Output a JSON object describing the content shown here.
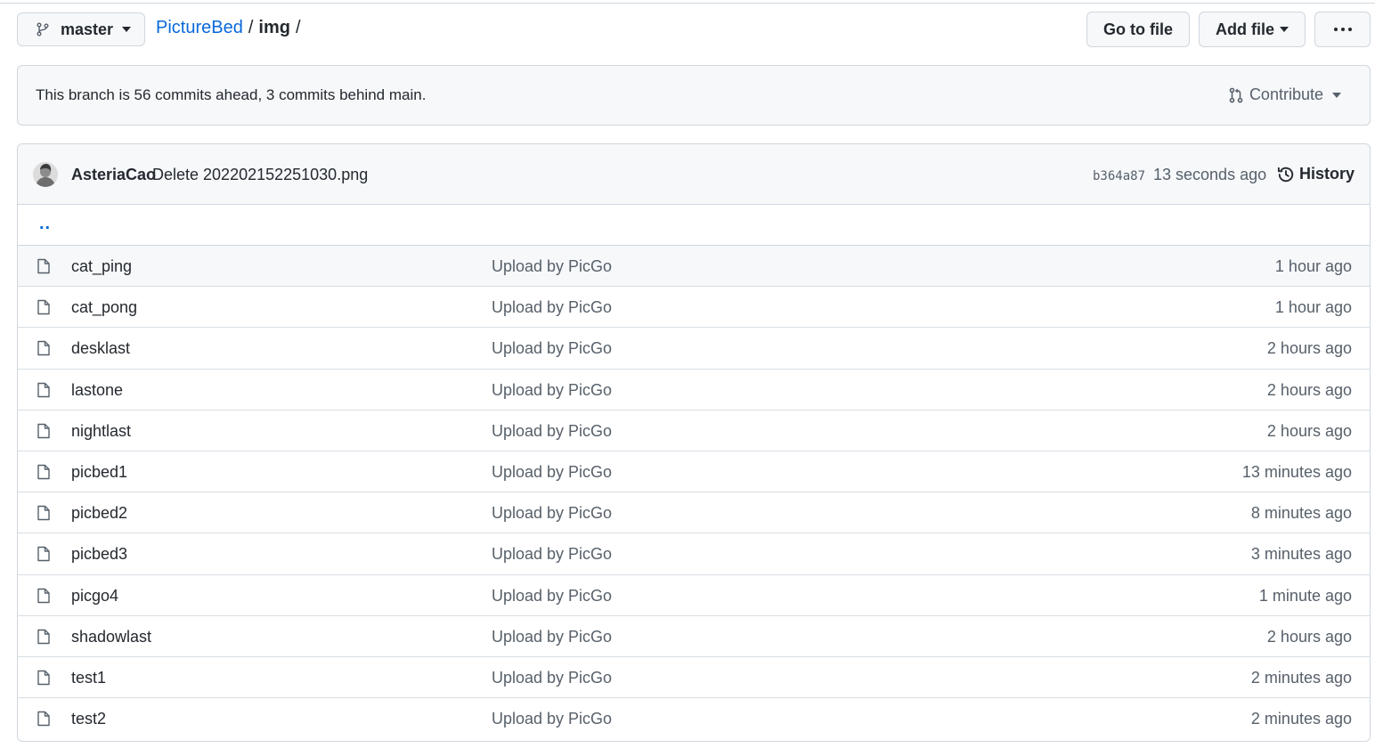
{
  "header": {
    "branch": "master",
    "breadcrumb": {
      "repo": "PictureBed",
      "sep1": "/",
      "folder": "img",
      "sep2": "/"
    },
    "go_to_file": "Go to file",
    "add_file": "Add file",
    "more": "···"
  },
  "banner": {
    "text": "This branch is 56 commits ahead, 3 commits behind main.",
    "contribute": "Contribute"
  },
  "latest_commit": {
    "author": "AsteriaCao",
    "message": "Delete 202202152251030.png",
    "sha": "b364a87",
    "time": "13 seconds ago",
    "history": "History"
  },
  "parent_dir": "..",
  "files": [
    {
      "name": "cat_ping",
      "message": "Upload by PicGo",
      "age": "1 hour ago"
    },
    {
      "name": "cat_pong",
      "message": "Upload by PicGo",
      "age": "1 hour ago"
    },
    {
      "name": "desklast",
      "message": "Upload by PicGo",
      "age": "2 hours ago"
    },
    {
      "name": "lastone",
      "message": "Upload by PicGo",
      "age": "2 hours ago"
    },
    {
      "name": "nightlast",
      "message": "Upload by PicGo",
      "age": "2 hours ago"
    },
    {
      "name": "picbed1",
      "message": "Upload by PicGo",
      "age": "13 minutes ago"
    },
    {
      "name": "picbed2",
      "message": "Upload by PicGo",
      "age": "8 minutes ago"
    },
    {
      "name": "picbed3",
      "message": "Upload by PicGo",
      "age": "3 minutes ago"
    },
    {
      "name": "picgo4",
      "message": "Upload by PicGo",
      "age": "1 minute ago"
    },
    {
      "name": "shadowlast",
      "message": "Upload by PicGo",
      "age": "2 hours ago"
    },
    {
      "name": "test1",
      "message": "Upload by PicGo",
      "age": "2 minutes ago"
    },
    {
      "name": "test2",
      "message": "Upload by PicGo",
      "age": "2 minutes ago"
    }
  ],
  "colors": {
    "link": "#0969da",
    "muted": "#57606a",
    "border": "#d0d7de",
    "subtle_bg": "#f6f8fa"
  }
}
